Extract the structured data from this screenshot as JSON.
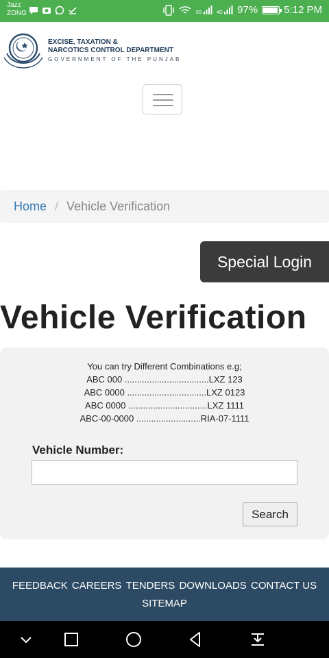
{
  "status_bar": {
    "carrier_line1": "Jazz",
    "carrier_line2": "ZONG",
    "network_label_a": "3G",
    "network_label_b": "4G",
    "battery": "97%",
    "battery_level": 0.97,
    "time": "5:12 PM",
    "background_color": "#4caf50"
  },
  "header": {
    "brand_line1": "EXCISE, TAXATION &",
    "brand_line2": "NARCOTICS CONTROL DEPARTMENT",
    "brand_line3": "GOVERNMENT OF THE PUNJAB",
    "menu_icon": "hamburger-icon"
  },
  "breadcrumb": {
    "home": "Home",
    "separator": "/",
    "current": "Vehicle Verification"
  },
  "special_login_label": "Special Login",
  "page_title": "Vehicle Verification",
  "form": {
    "hint_intro": "You can try Different Combinations e.g;",
    "hint_examples": [
      "ABC 000 ..................................LXZ 123",
      "ABC 0000 ................................LXZ 0123",
      "ABC 0000 ................................LXZ 1111",
      "ABC-00-0000 ..........................RIA-07-1111"
    ],
    "vehicle_label": "Vehicle Number:",
    "vehicle_value": "",
    "search_label": "Search"
  },
  "footer": {
    "links": [
      "FEEDBACK",
      "CAREERS",
      "TENDERS",
      "DOWNLOADS",
      "CONTACT US"
    ],
    "sitemap": "SITEMAP",
    "background_color": "#2c4a63"
  },
  "nav_bar": {
    "icons": [
      "chevron-down-icon",
      "recents-icon",
      "home-icon",
      "back-icon",
      "notifications-pull-icon"
    ]
  }
}
